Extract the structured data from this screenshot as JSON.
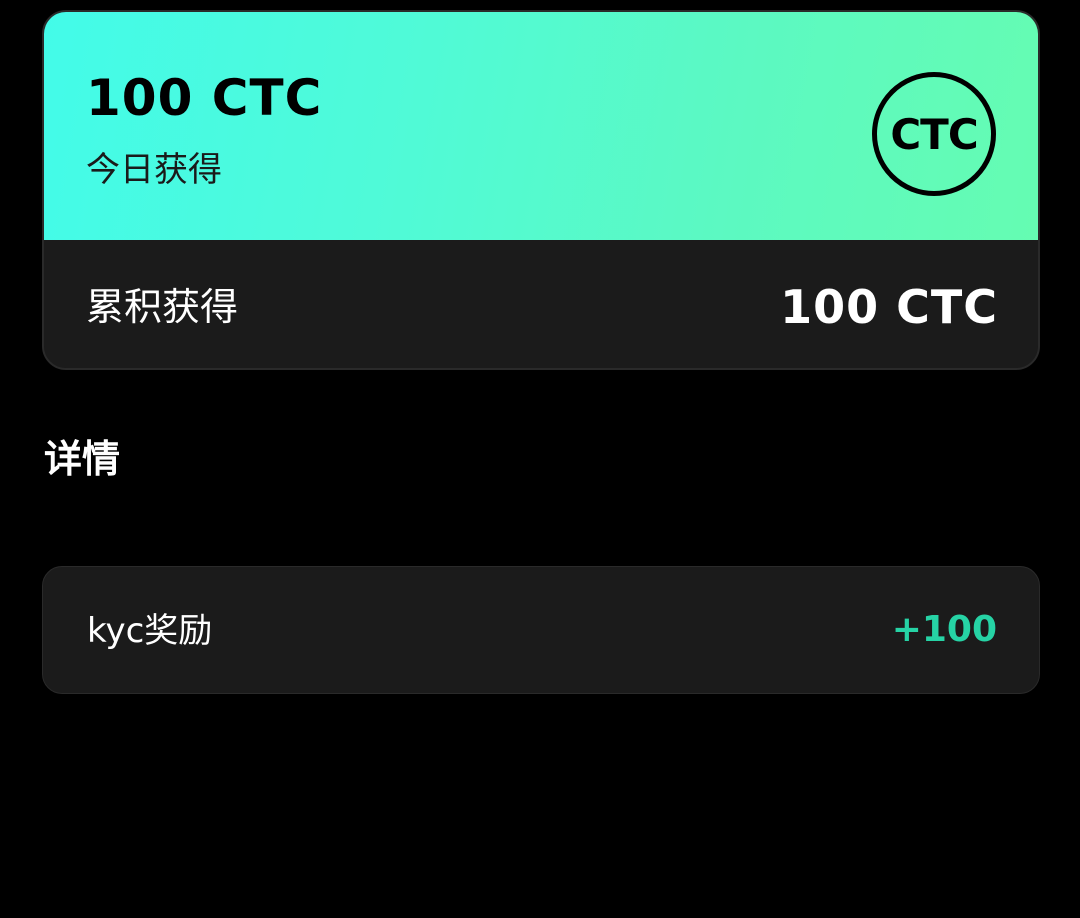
{
  "summary": {
    "today_amount": "100 CTC",
    "today_label": "今日获得",
    "logo_text": "CTC",
    "total_label": "累积获得",
    "total_amount": "100 CTC"
  },
  "details": {
    "title": "详情",
    "items": [
      {
        "label": "kyc奖励",
        "value": "+100"
      }
    ]
  },
  "colors": {
    "gradient_start": "#43fbe9",
    "gradient_end": "#65fcb2",
    "positive_value": "#26d3a5",
    "card_background": "#1b1b1b",
    "page_background": "#000000"
  }
}
